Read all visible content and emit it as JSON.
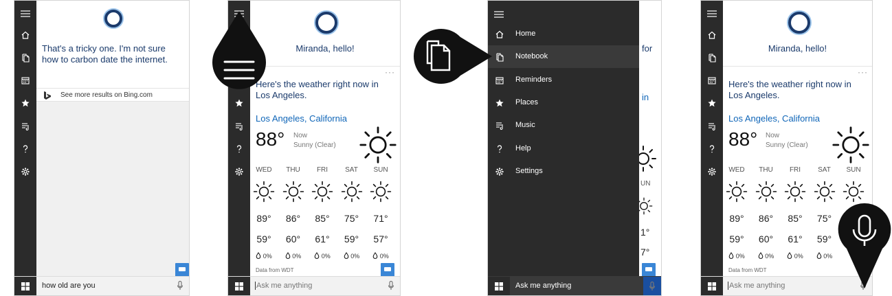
{
  "panel1": {
    "reply": "That's a tricky one. I'm not sure how to carbon date the internet.",
    "bing_link": "See more results on Bing.com",
    "query": "how old are you"
  },
  "panel2": {
    "greeting": "Miranda, hello!",
    "headline": "Here's the weather right now in Los Angeles.",
    "location": "Los Angeles, California",
    "temp": "88°",
    "now_label": "Now",
    "condition": "Sunny (Clear)",
    "days": [
      "WED",
      "THU",
      "FRI",
      "SAT",
      "SUN"
    ],
    "highs": [
      "89°",
      "86°",
      "85°",
      "75°",
      "71°"
    ],
    "lows": [
      "59°",
      "60°",
      "61°",
      "59°",
      "57°"
    ],
    "precip": [
      "0%",
      "0%",
      "0%",
      "0%",
      "0%"
    ],
    "source": "Data from WDT",
    "dots": "···",
    "search_placeholder": "Ask me anything"
  },
  "panel3": {
    "menu": [
      "Home",
      "Notebook",
      "Reminders",
      "Places",
      "Music",
      "Help",
      "Settings"
    ],
    "search_placeholder": "Ask me anything",
    "peek": {
      "for": "for",
      "in": "in",
      "un": "UN",
      "one": "1°",
      "seven": "7°"
    }
  },
  "panel4": {
    "greeting": "Miranda, hello!",
    "headline": "Here's the weather right now in Los Angeles.",
    "location": "Los Angeles, California",
    "temp": "88°",
    "now_label": "Now",
    "condition": "Sunny (Clear)",
    "days": [
      "WED",
      "THU",
      "FRI",
      "SAT",
      "SUN"
    ],
    "highs": [
      "89°",
      "86°",
      "85°",
      "75°",
      "75°"
    ],
    "lows": [
      "59°",
      "60°",
      "61°",
      "59°"
    ],
    "precip": [
      "0%",
      "0%",
      "0%",
      "0%"
    ],
    "source": "Data from WDT",
    "dots": "···",
    "search_placeholder": "Ask me anything"
  },
  "colors": {
    "rail": "#2b2b2b",
    "accent": "#1066b8",
    "heading": "#1a3a6b",
    "callout": "#111111"
  },
  "icons": [
    "hamburger-icon",
    "home-icon",
    "notebook-icon",
    "reminders-icon",
    "places-icon",
    "music-icon",
    "help-icon",
    "settings-icon",
    "windows-icon",
    "microphone-icon",
    "bing-icon",
    "sun-icon",
    "droplet-icon",
    "feedback-icon"
  ]
}
